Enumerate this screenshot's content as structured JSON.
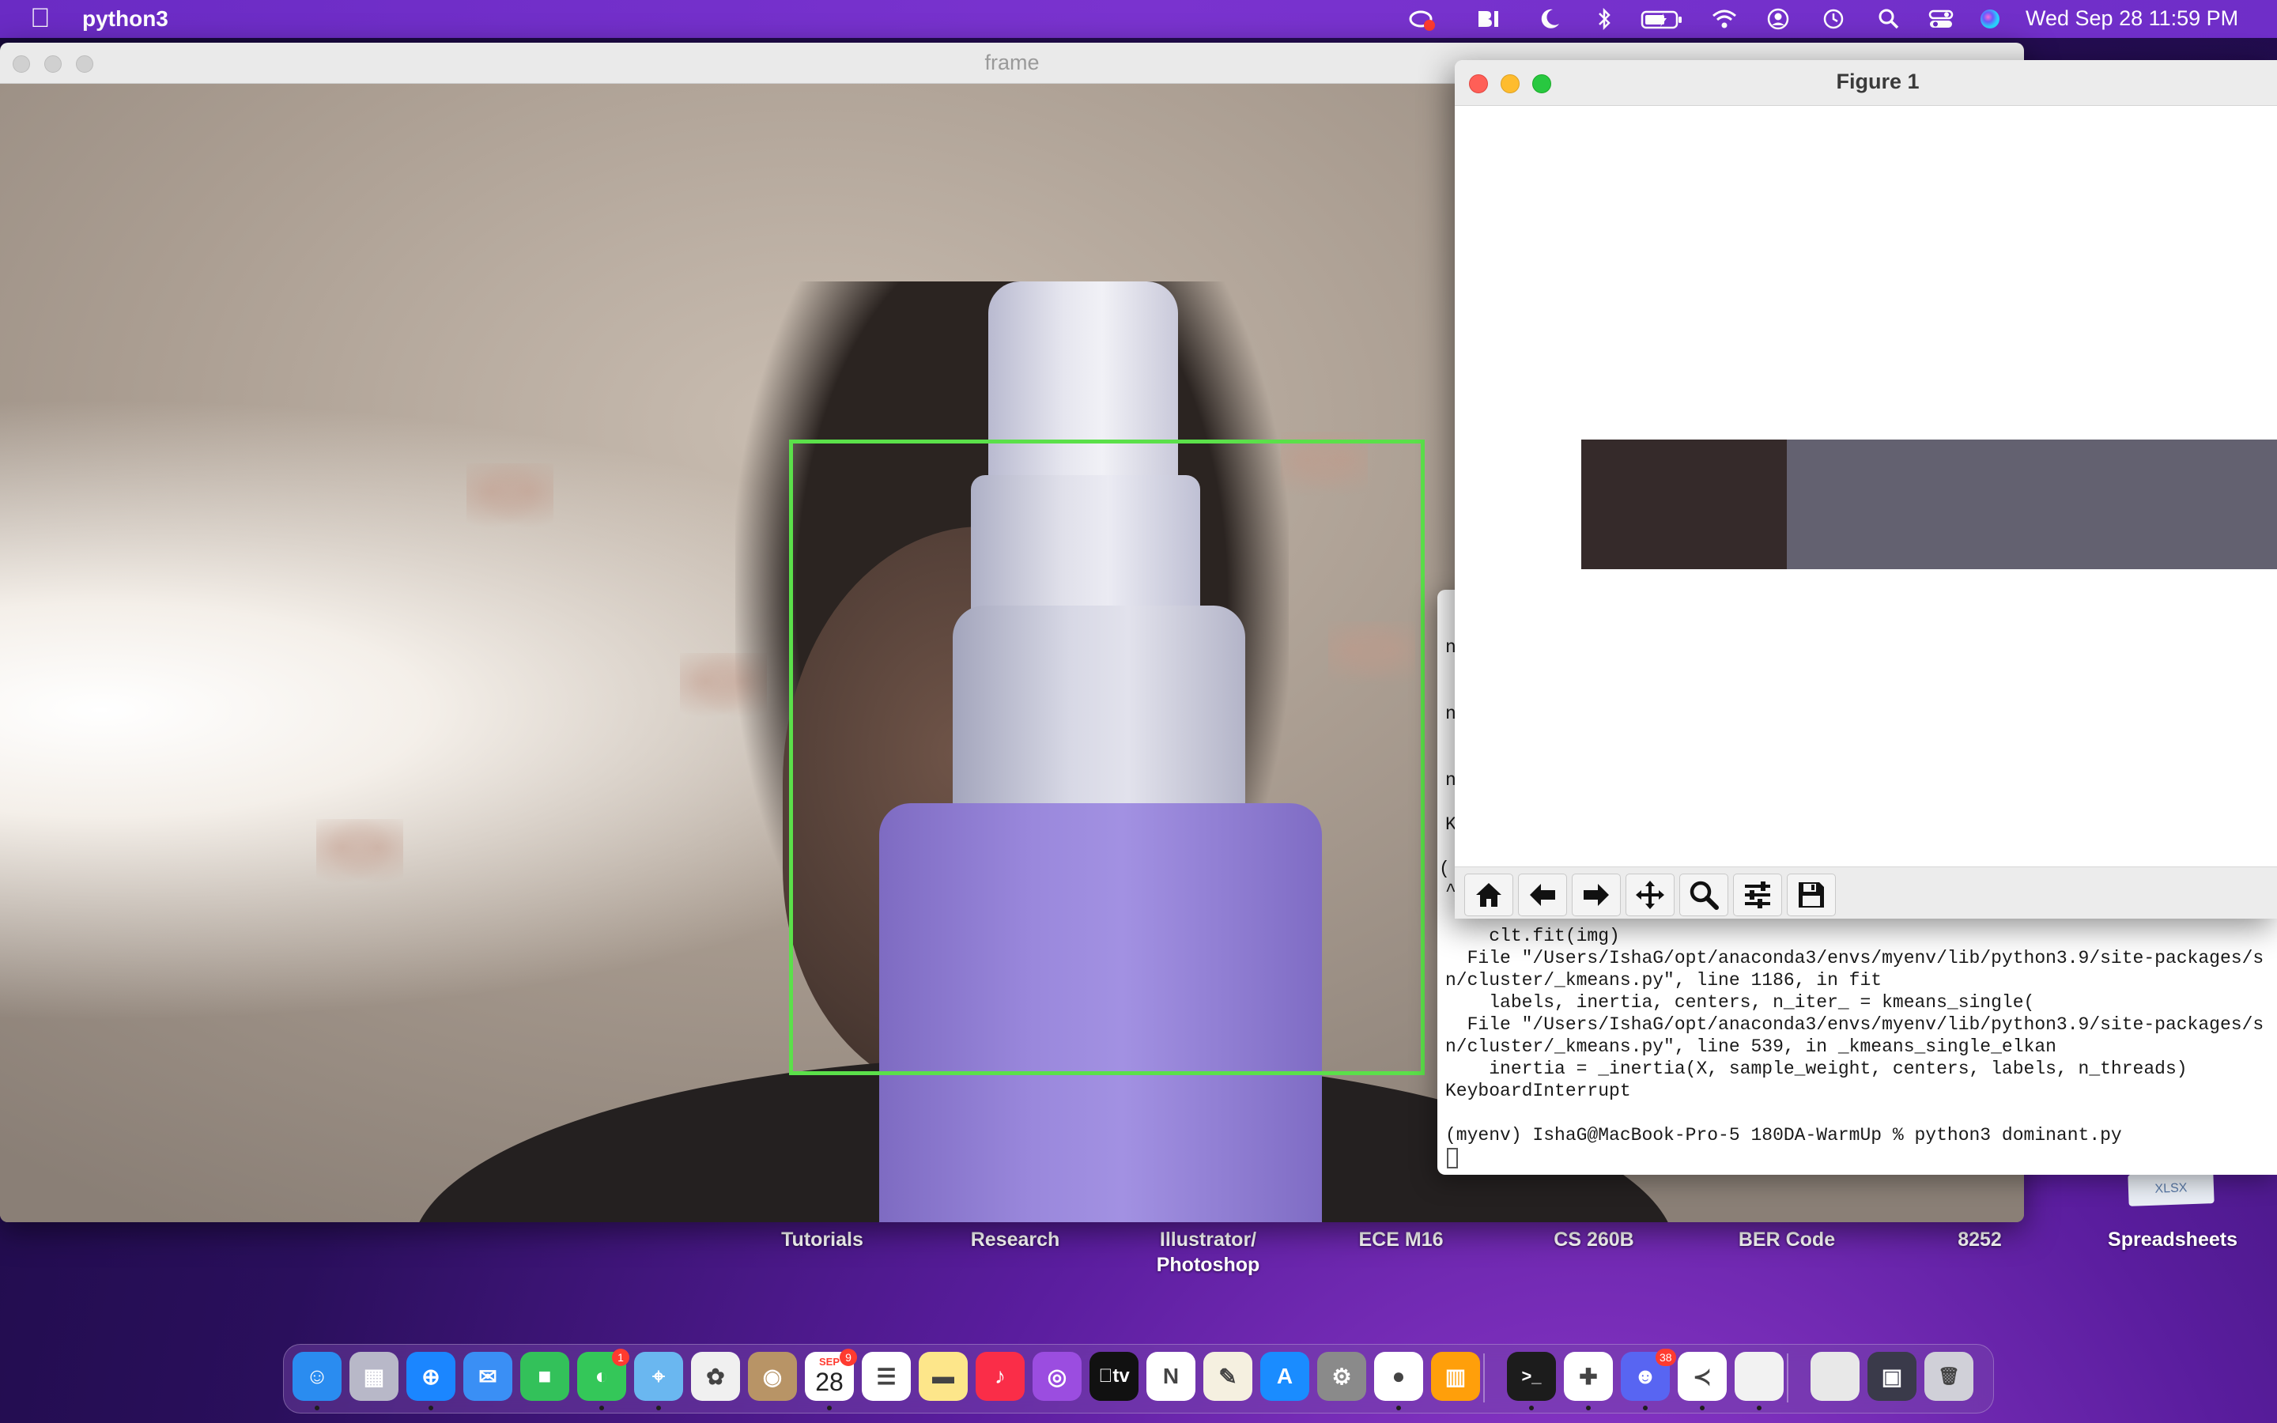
{
  "menubar": {
    "app_name": "python3",
    "clock": "Wed Sep 28  11:59 PM",
    "status_icons": [
      "creative-cloud-icon",
      "bi-icon",
      "moon-icon",
      "bluetooth-icon",
      "battery-icon",
      "wifi-icon",
      "user-icon",
      "time-machine-icon",
      "search-icon",
      "control-center-icon",
      "siri-icon"
    ]
  },
  "frame_window": {
    "title": "frame"
  },
  "figure_window": {
    "title": "Figure 1",
    "color_bar": [
      {
        "color": "#352a2a",
        "fraction": 0.26
      },
      {
        "color": "#636170",
        "fraction": 0.74
      }
    ],
    "toolbar": [
      "home-icon",
      "back-arrow-icon",
      "forward-arrow-icon",
      "pan-icon",
      "zoom-icon",
      "configure-icon",
      "save-icon"
    ]
  },
  "terminal": {
    "gutter": [
      "n",
      "n",
      "n",
      "K",
      "(",
      "^"
    ],
    "lines": [
      "    clt.fit(img)",
      "  File \"/Users/IshaG/opt/anaconda3/envs/myenv/lib/python3.9/site-packages/s",
      "n/cluster/_kmeans.py\", line 1186, in fit",
      "    labels, inertia, centers, n_iter_ = kmeans_single(",
      "  File \"/Users/IshaG/opt/anaconda3/envs/myenv/lib/python3.9/site-packages/s",
      "n/cluster/_kmeans.py\", line 539, in _kmeans_single_elkan",
      "    inertia = _inertia(X, sample_weight, centers, labels, n_threads)",
      "KeyboardInterrupt",
      "",
      "(myenv) IshaG@MacBook-Pro-5 180DA-WarmUp % python3 dominant.py"
    ]
  },
  "desktop": {
    "folders": [
      "Tutorials",
      "Research",
      "Illustrator/\nPhotoshop",
      "ECE M16",
      "CS 260B",
      "BER Code",
      "8252",
      "Spreadsheets"
    ],
    "xlsx_label": "XLSX"
  },
  "dock": {
    "calendar_month": "SEP",
    "calendar_day": "28",
    "tv_label": "tv",
    "messages_badge": "1",
    "calendar_badge": "9",
    "discord_badge": "38",
    "apps": [
      {
        "name": "finder",
        "color": "#2a8cf0",
        "glyph": "☺"
      },
      {
        "name": "launchpad",
        "color": "#b8b8c8",
        "glyph": "▦"
      },
      {
        "name": "safari",
        "color": "#1b86ff",
        "glyph": "⊕"
      },
      {
        "name": "mail",
        "color": "#3a8ff5",
        "glyph": "✉"
      },
      {
        "name": "facetime",
        "color": "#33c15a",
        "glyph": "■"
      },
      {
        "name": "messages",
        "color": "#34c759",
        "glyph": "◐"
      },
      {
        "name": "maps",
        "color": "#6ab7f0",
        "glyph": "⌖"
      },
      {
        "name": "photos",
        "color": "#f0f0f0",
        "glyph": "✿"
      },
      {
        "name": "contacts",
        "color": "#b89466",
        "glyph": "◉"
      },
      {
        "name": "calendar",
        "color": "#ffffff",
        "glyph": ""
      },
      {
        "name": "reminders",
        "color": "#ffffff",
        "glyph": "☰"
      },
      {
        "name": "notes",
        "color": "#fde68a",
        "glyph": "▬"
      },
      {
        "name": "music",
        "color": "#fa2d48",
        "glyph": "♪"
      },
      {
        "name": "podcasts",
        "color": "#9b4de0",
        "glyph": "◎"
      },
      {
        "name": "tv",
        "color": "#111111",
        "glyph": ""
      },
      {
        "name": "news",
        "color": "#ffffff",
        "glyph": "N"
      },
      {
        "name": "keynote",
        "color": "#f5f0e0",
        "glyph": "✎"
      },
      {
        "name": "app-store",
        "color": "#1a8cff",
        "glyph": "A"
      },
      {
        "name": "system-preferences",
        "color": "#8a8a8a",
        "glyph": "⚙"
      },
      {
        "name": "chrome",
        "color": "#ffffff",
        "glyph": "●"
      },
      {
        "name": "books",
        "color": "#ff9f0a",
        "glyph": "▥"
      },
      {
        "name": "terminal",
        "color": "#1c1c1c",
        "glyph": ">_"
      },
      {
        "name": "slack",
        "color": "#ffffff",
        "glyph": "✚"
      },
      {
        "name": "discord",
        "color": "#5865f2",
        "glyph": "☻"
      },
      {
        "name": "vscode",
        "color": "#ffffff",
        "glyph": "≺"
      },
      {
        "name": "document",
        "color": "#f2f2f2",
        "glyph": ""
      },
      {
        "name": "python-doc",
        "color": "#e8e8e8",
        "glyph": ""
      },
      {
        "name": "screenshot-stack",
        "color": "#3a3a4a",
        "glyph": "▣"
      },
      {
        "name": "trash",
        "color": "#d0d0d8",
        "glyph": "🗑"
      }
    ]
  }
}
